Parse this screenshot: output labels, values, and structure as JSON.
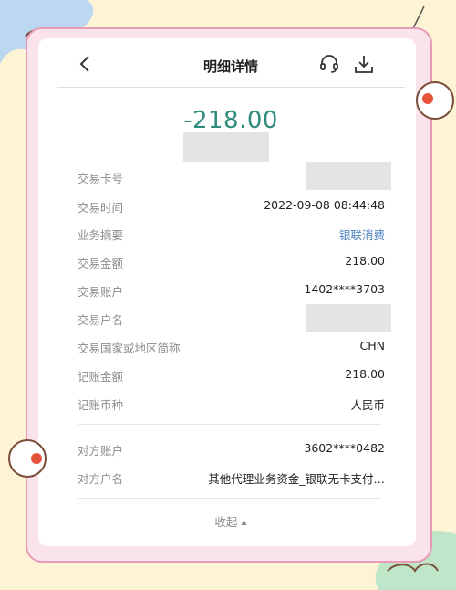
{
  "header": {
    "title": "明细详情",
    "back_icon": "chevron-left-icon",
    "service_icon": "headset-icon",
    "download_icon": "download-icon"
  },
  "amount": "-218.00",
  "rows": [
    {
      "label": "交易卡号",
      "value": ""
    },
    {
      "label": "交易时间",
      "value": "2022-09-08 08:44:48"
    },
    {
      "label": "业务摘要",
      "value": "银联消费"
    },
    {
      "label": "交易金额",
      "value": "218.00"
    },
    {
      "label": "交易账户",
      "value": "1402****3703"
    },
    {
      "label": "交易户名",
      "value": ""
    },
    {
      "label": "交易国家或地区简称",
      "value": "CHN"
    },
    {
      "label": "记账金额",
      "value": "218.00"
    },
    {
      "label": "记账币种",
      "value": "人民币"
    }
  ],
  "counterparty": [
    {
      "label": "对方账户",
      "value": "3602****0482"
    },
    {
      "label": "对方户名",
      "value": "其他代理业务资金_银联无卡支付…"
    }
  ],
  "footer": {
    "collapse_label": "收起",
    "collapse_icon": "caret-up-icon"
  },
  "colors": {
    "amount": "#2f8c7c",
    "link": "#4a7fbe",
    "frame_pink": "#fbe3ec",
    "background": "#fdf4d6"
  }
}
